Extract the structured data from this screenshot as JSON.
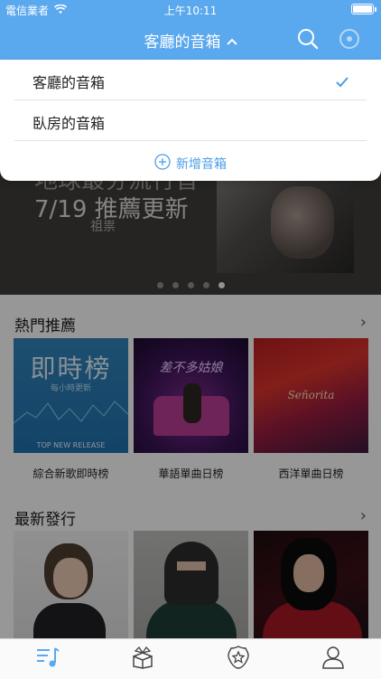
{
  "status_bar": {
    "carrier": "電信業者",
    "time": "上午10:11"
  },
  "nav": {
    "title": "客廳的音箱",
    "chevron": "⌃"
  },
  "banner": {
    "title_line1": "地球最夯流行音",
    "title_line2": "7/19 推薦更新",
    "subtitle": "祖祟",
    "page_count": 5,
    "active_page": 5
  },
  "sections": {
    "hot": {
      "title": "熱門推薦",
      "more": "›",
      "items": [
        {
          "caption": "綜合新歌即時榜",
          "cover_title": "即時榜",
          "cover_sub": "每小時更新",
          "cover_footer": "TOP NEW RELEASE"
        },
        {
          "caption": "華語單曲日榜",
          "cover_title": "差不多姑娘"
        },
        {
          "caption": "西洋單曲日榜",
          "cover_title": "Señorita"
        }
      ]
    },
    "new": {
      "title": "最新發行",
      "more": "›"
    }
  },
  "dropdown": {
    "items": [
      {
        "label": "客廳的音箱",
        "selected": true
      },
      {
        "label": "臥房的音箱",
        "selected": false
      }
    ],
    "add_label": "新增音箱"
  },
  "colors": {
    "accent": "#5aa8ee",
    "link": "#4a9ee8"
  },
  "tabs": [
    "playlist-icon",
    "gift-box-icon",
    "star-badge-icon",
    "profile-icon"
  ]
}
